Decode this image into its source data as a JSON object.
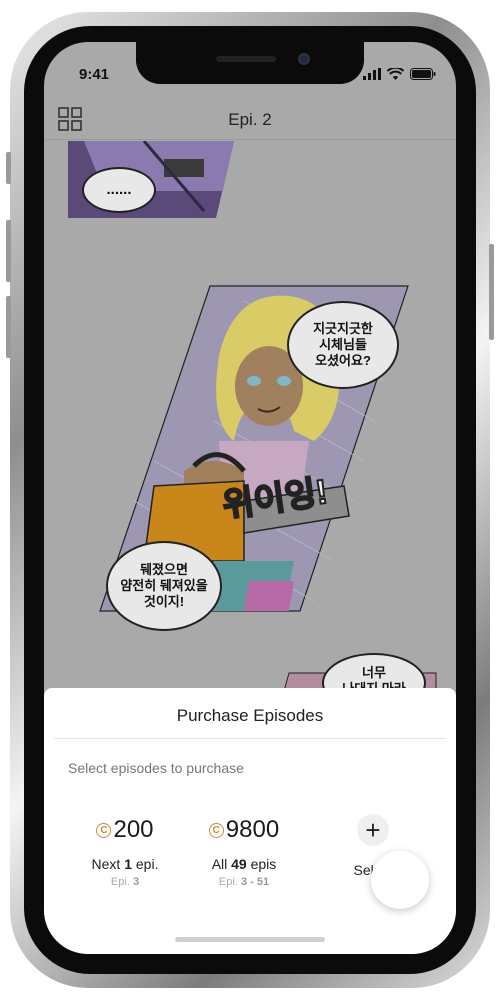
{
  "status": {
    "time": "9:41"
  },
  "header": {
    "title": "Epi. 2"
  },
  "comic": {
    "bubble_top": "......",
    "bubble_right": "지긋지긋한\n시체님들\n오셨어요?",
    "bubble_left": "뒈졌으면\n얌전히 뒈져있을\n것이지!",
    "sfx": "위이잉!",
    "bubble_bottom": "너무\n나대지 마라"
  },
  "purchase": {
    "title": "Purchase Episodes",
    "subtitle": "Select episodes to purchase",
    "options": [
      {
        "price": "200",
        "label_prefix": "Next ",
        "label_count": "1",
        "label_suffix": " epi.",
        "range_prefix": "Epi. ",
        "range": "3"
      },
      {
        "price": "9800",
        "label_prefix": "All ",
        "label_count": "49",
        "label_suffix": " epis",
        "range_prefix": "Epi. ",
        "range": "3 - 51"
      },
      {
        "symbol": "+",
        "label": "Select"
      }
    ]
  },
  "colors": {
    "overlay": "#a9a9a9",
    "coin": "#c88b3a",
    "sheet": "#ffffff"
  }
}
